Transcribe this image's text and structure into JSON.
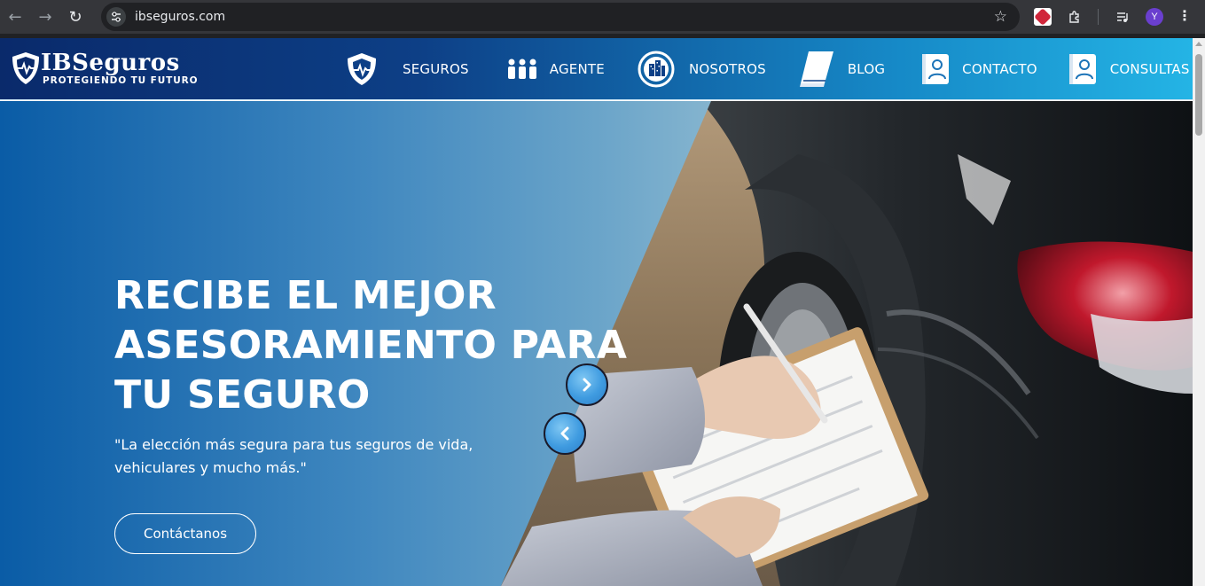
{
  "browser": {
    "url": "ibseguros.com",
    "profile_initial": "Y",
    "icons": [
      "back-arrow-icon",
      "forward-arrow-icon",
      "reload-icon",
      "site-settings-icon",
      "bookmark-star-icon",
      "vpn-extension-icon",
      "extensions-puzzle-icon",
      "media-controls-icon",
      "more-menu-icon"
    ]
  },
  "site": {
    "logo": {
      "brand": "IBSeguros",
      "tagline": "PROTEGIENDO TU FUTURO"
    },
    "menu": [
      {
        "label": "SEGUROS",
        "icon": "shield-heartbeat-icon"
      },
      {
        "label": "AGENTE",
        "icon": "people-group-icon"
      },
      {
        "label": "NOSOTROS",
        "icon": "buildings-icon"
      },
      {
        "label": "BLOG",
        "icon": "book-icon"
      },
      {
        "label": "CONTACTO",
        "icon": "contact-card-icon"
      },
      {
        "label": "CONSULTAS",
        "icon": "contact-card-icon"
      }
    ]
  },
  "hero": {
    "title": "RECIBE EL MEJOR ASESORAMIENTO PARA TU SEGURO",
    "subtitle": "\"La elección más segura para tus seguros de vida, vehiculares y mucho más.\"",
    "cta_label": "Contáctanos",
    "slider": {
      "next_icon": "chevron-right-icon",
      "prev_icon": "chevron-left-icon"
    }
  },
  "colors": {
    "header_start": "#0a2a6b",
    "header_end": "#24b4e5",
    "hero_blue": "#0a5ca6",
    "slider_button": "#3f9be0"
  }
}
